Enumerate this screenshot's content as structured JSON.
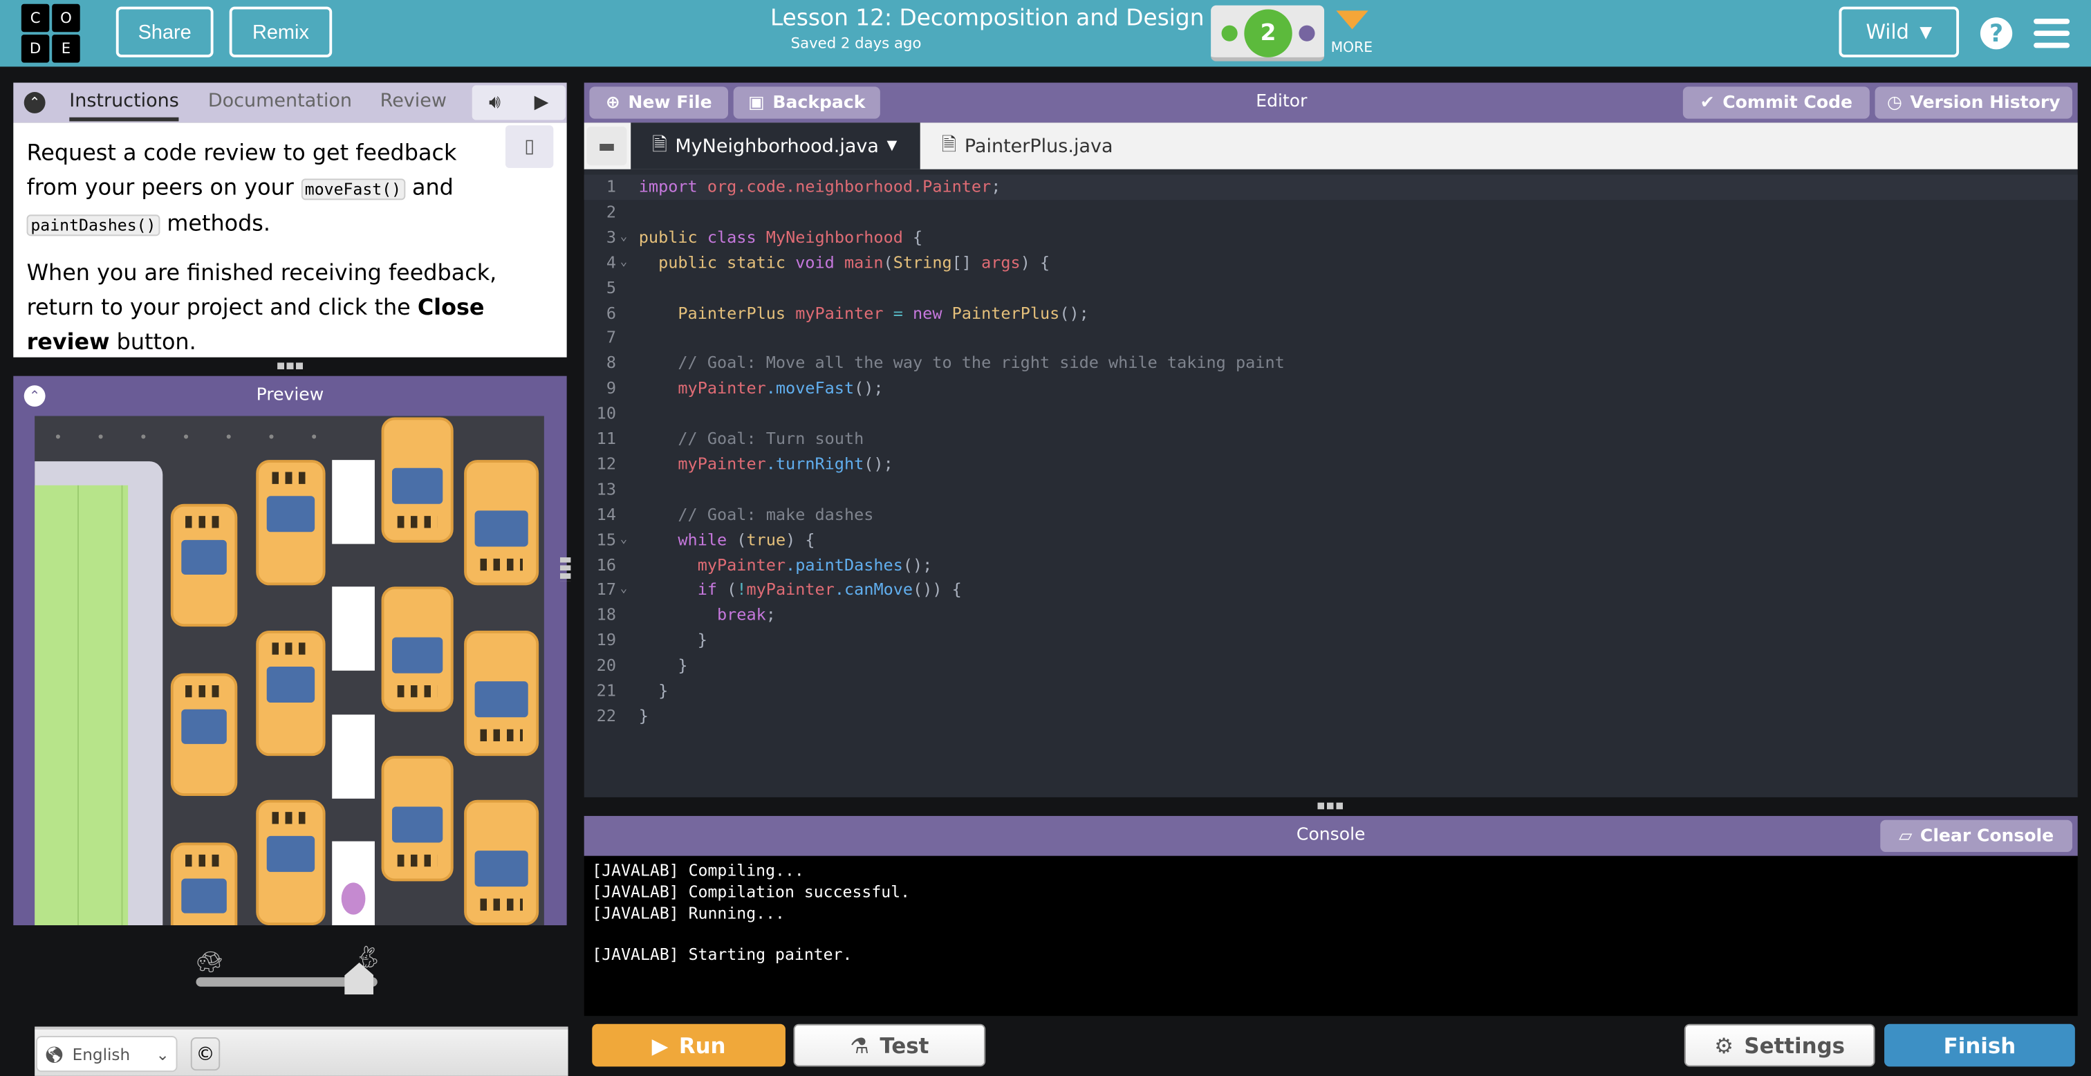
{
  "header": {
    "logo_letters": [
      "C",
      "O",
      "D",
      "E"
    ],
    "share": "Share",
    "remix": "Remix",
    "lesson_title": "Lesson 12: Decomposition and Design",
    "saved": "Saved 2 days ago",
    "level": "2",
    "more": "MORE",
    "user": "Wild",
    "colors": {
      "header": "#4eaabd",
      "level_green": "#5cba3c",
      "level_purple": "#7665a0",
      "more": "#f5a638"
    }
  },
  "instructions": {
    "tabs": [
      "Instructions",
      "Documentation",
      "Review"
    ],
    "active_tab": "Instructions",
    "p1_a": "Request a code review to get feedback from your peers on your ",
    "p1_code1": "moveFast()",
    "p1_b": " and ",
    "p1_code2": "paintDashes()",
    "p1_c": " methods.",
    "p2_a": "When you are finished receiving feedback, return to your project and click the ",
    "p2_bold1": "Close review",
    "p2_b": " button."
  },
  "preview": {
    "title": "Preview",
    "speed_level": 0.9
  },
  "footer": {
    "language": "English",
    "copyright": "©"
  },
  "editor": {
    "title": "Editor",
    "new_file": "New File",
    "backpack": "Backpack",
    "commit": "Commit Code",
    "history": "Version History",
    "tabs": [
      {
        "name": "MyNeighborhood.java",
        "active": true
      },
      {
        "name": "PainterPlus.java",
        "active": false
      }
    ],
    "lines": [
      [
        [
          "import",
          "k"
        ],
        [
          " org.code.neighborhood.Painter",
          "v"
        ],
        [
          ";",
          "p"
        ]
      ],
      [],
      [
        [
          "public",
          "t"
        ],
        [
          " class",
          "k"
        ],
        [
          " MyNeighborhood",
          "v"
        ],
        [
          " {",
          "p"
        ]
      ],
      [
        [
          "  public static",
          "t"
        ],
        [
          " void",
          "k"
        ],
        [
          " main",
          "v"
        ],
        [
          "(",
          "p"
        ],
        [
          "String",
          "t"
        ],
        [
          "[] ",
          "p"
        ],
        [
          "args",
          "v"
        ],
        [
          ") {",
          "p"
        ]
      ],
      [],
      [
        [
          "    PainterPlus",
          "t"
        ],
        [
          " myPainter",
          "v"
        ],
        [
          " =",
          "o"
        ],
        [
          " new",
          "k"
        ],
        [
          " PainterPlus",
          "t"
        ],
        [
          "();",
          "p"
        ]
      ],
      [],
      [
        [
          "    // Goal: Move all the way to the right side while taking paint",
          "c"
        ]
      ],
      [
        [
          "    myPainter",
          "v"
        ],
        [
          ".moveFast",
          "m"
        ],
        [
          "();",
          "p"
        ]
      ],
      [],
      [
        [
          "    // Goal: Turn south",
          "c"
        ]
      ],
      [
        [
          "    myPainter",
          "v"
        ],
        [
          ".turnRight",
          "m"
        ],
        [
          "();",
          "p"
        ]
      ],
      [],
      [
        [
          "    // Goal: make dashes",
          "c"
        ]
      ],
      [
        [
          "    while",
          "k"
        ],
        [
          " (",
          "p"
        ],
        [
          "true",
          "t"
        ],
        [
          ") {",
          "p"
        ]
      ],
      [
        [
          "      myPainter",
          "v"
        ],
        [
          ".paintDashes",
          "m"
        ],
        [
          "();",
          "p"
        ]
      ],
      [
        [
          "      if",
          "k"
        ],
        [
          " (",
          "p"
        ],
        [
          "!",
          "o"
        ],
        [
          "myPainter",
          "v"
        ],
        [
          ".canMove",
          "m"
        ],
        [
          "()) {",
          "p"
        ]
      ],
      [
        [
          "        break",
          "k"
        ],
        [
          ";",
          "p"
        ]
      ],
      [
        [
          "      }",
          "p"
        ]
      ],
      [
        [
          "    }",
          "p"
        ]
      ],
      [
        [
          "  }",
          "p"
        ]
      ],
      [
        [
          "}",
          "p"
        ]
      ]
    ],
    "foldable": [
      3,
      4,
      15,
      17
    ]
  },
  "console": {
    "title": "Console",
    "clear": "Clear Console",
    "lines": [
      "[JAVALAB] Compiling...",
      "[JAVALAB] Compilation successful.",
      "[JAVALAB] Running...",
      "",
      "[JAVALAB] Starting painter."
    ]
  },
  "actions": {
    "run": "Run",
    "test": "Test",
    "settings": "Settings",
    "finish": "Finish"
  }
}
